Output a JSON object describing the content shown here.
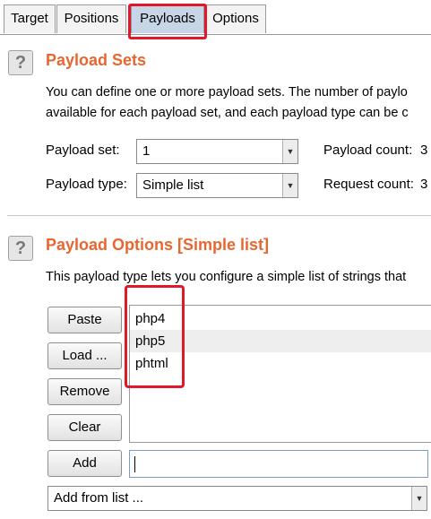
{
  "tabs": [
    {
      "label": "Target"
    },
    {
      "label": "Positions"
    },
    {
      "label": "Payloads"
    },
    {
      "label": "Options"
    }
  ],
  "payload_sets": {
    "help_glyph": "?",
    "title": "Payload Sets",
    "desc_line1": "You can define one or more payload sets. The number of paylo",
    "desc_line2": "available for each payload set, and each payload type can be c",
    "set_label": "Payload set:",
    "set_value": "1",
    "count_label": "Payload count:",
    "count_value": "3",
    "type_label": "Payload type:",
    "type_value": "Simple list",
    "request_label": "Request count:",
    "request_value": "3"
  },
  "payload_options": {
    "help_glyph": "?",
    "title": "Payload Options [Simple list]",
    "desc": "This payload type lets you configure a simple list of strings that",
    "buttons": {
      "paste": "Paste",
      "load": "Load ...",
      "remove": "Remove",
      "clear": "Clear",
      "add": "Add"
    },
    "list_items": [
      "php4",
      "php5",
      "phtml"
    ],
    "add_input_value": "",
    "add_from_list": "Add from list ..."
  },
  "colors": {
    "section_title": "#e8662f",
    "highlight": "#e0192a",
    "active_tab": "#c7d6e6"
  }
}
